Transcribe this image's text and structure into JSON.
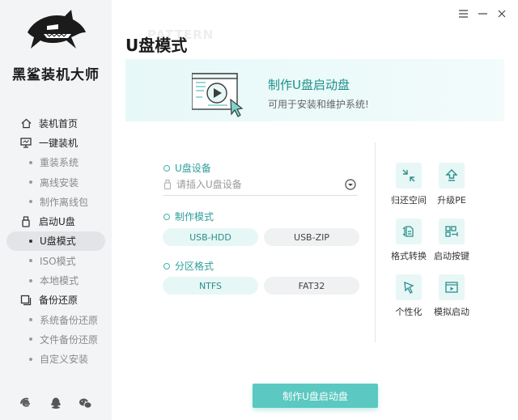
{
  "app": {
    "name": "黑鲨装机大师"
  },
  "sidebar": {
    "items": [
      {
        "label": "装机首页",
        "type": "primary",
        "icon": "home-icon"
      },
      {
        "label": "一键装机",
        "type": "primary",
        "icon": "monitor-icon"
      },
      {
        "label": "重装系统",
        "type": "sub"
      },
      {
        "label": "离线安装",
        "type": "sub"
      },
      {
        "label": "制作离线包",
        "type": "sub"
      },
      {
        "label": "启动U盘",
        "type": "primary",
        "icon": "usb-icon"
      },
      {
        "label": "U盘模式",
        "type": "sub",
        "active": true
      },
      {
        "label": "ISO模式",
        "type": "sub"
      },
      {
        "label": "本地模式",
        "type": "sub"
      },
      {
        "label": "备份还原",
        "type": "primary",
        "icon": "backup-icon"
      },
      {
        "label": "系统备份还原",
        "type": "sub"
      },
      {
        "label": "文件备份还原",
        "type": "sub"
      },
      {
        "label": "自定义安装",
        "type": "sub"
      }
    ],
    "footer_icons": [
      "browser-e-icon",
      "qq-icon",
      "wechat-icon"
    ]
  },
  "window_controls": [
    "menu-icon",
    "minimize-icon",
    "close-icon"
  ],
  "page": {
    "title": "U盘模式",
    "title_bg": "PATTERN"
  },
  "banner": {
    "title": "制作U盘启动盘",
    "subtitle": "可用于安装和维护系统!"
  },
  "form": {
    "device_label": "U盘设备",
    "device_placeholder": "请插入U盘设备",
    "mode_label": "制作模式",
    "mode_options": [
      "USB-HDD",
      "USB-ZIP"
    ],
    "mode_selected": "USB-HDD",
    "partition_label": "分区格式",
    "partition_options": [
      "NTFS",
      "FAT32"
    ],
    "partition_selected": "NTFS"
  },
  "tools": [
    {
      "label": "归还空间",
      "icon": "restore-space-icon"
    },
    {
      "label": "升级PE",
      "icon": "upgrade-icon"
    },
    {
      "label": "格式转换",
      "icon": "format-convert-icon"
    },
    {
      "label": "启动按键",
      "icon": "boot-key-icon"
    },
    {
      "label": "个性化",
      "icon": "personalize-icon"
    },
    {
      "label": "模拟启动",
      "icon": "simulate-boot-icon"
    }
  ],
  "actions": {
    "make_button": "制作U盘启动盘"
  },
  "colors": {
    "accent": "#5bc8c1",
    "accent_text": "#2e9e9a",
    "sidebar_bg": "#f3f4f6"
  }
}
